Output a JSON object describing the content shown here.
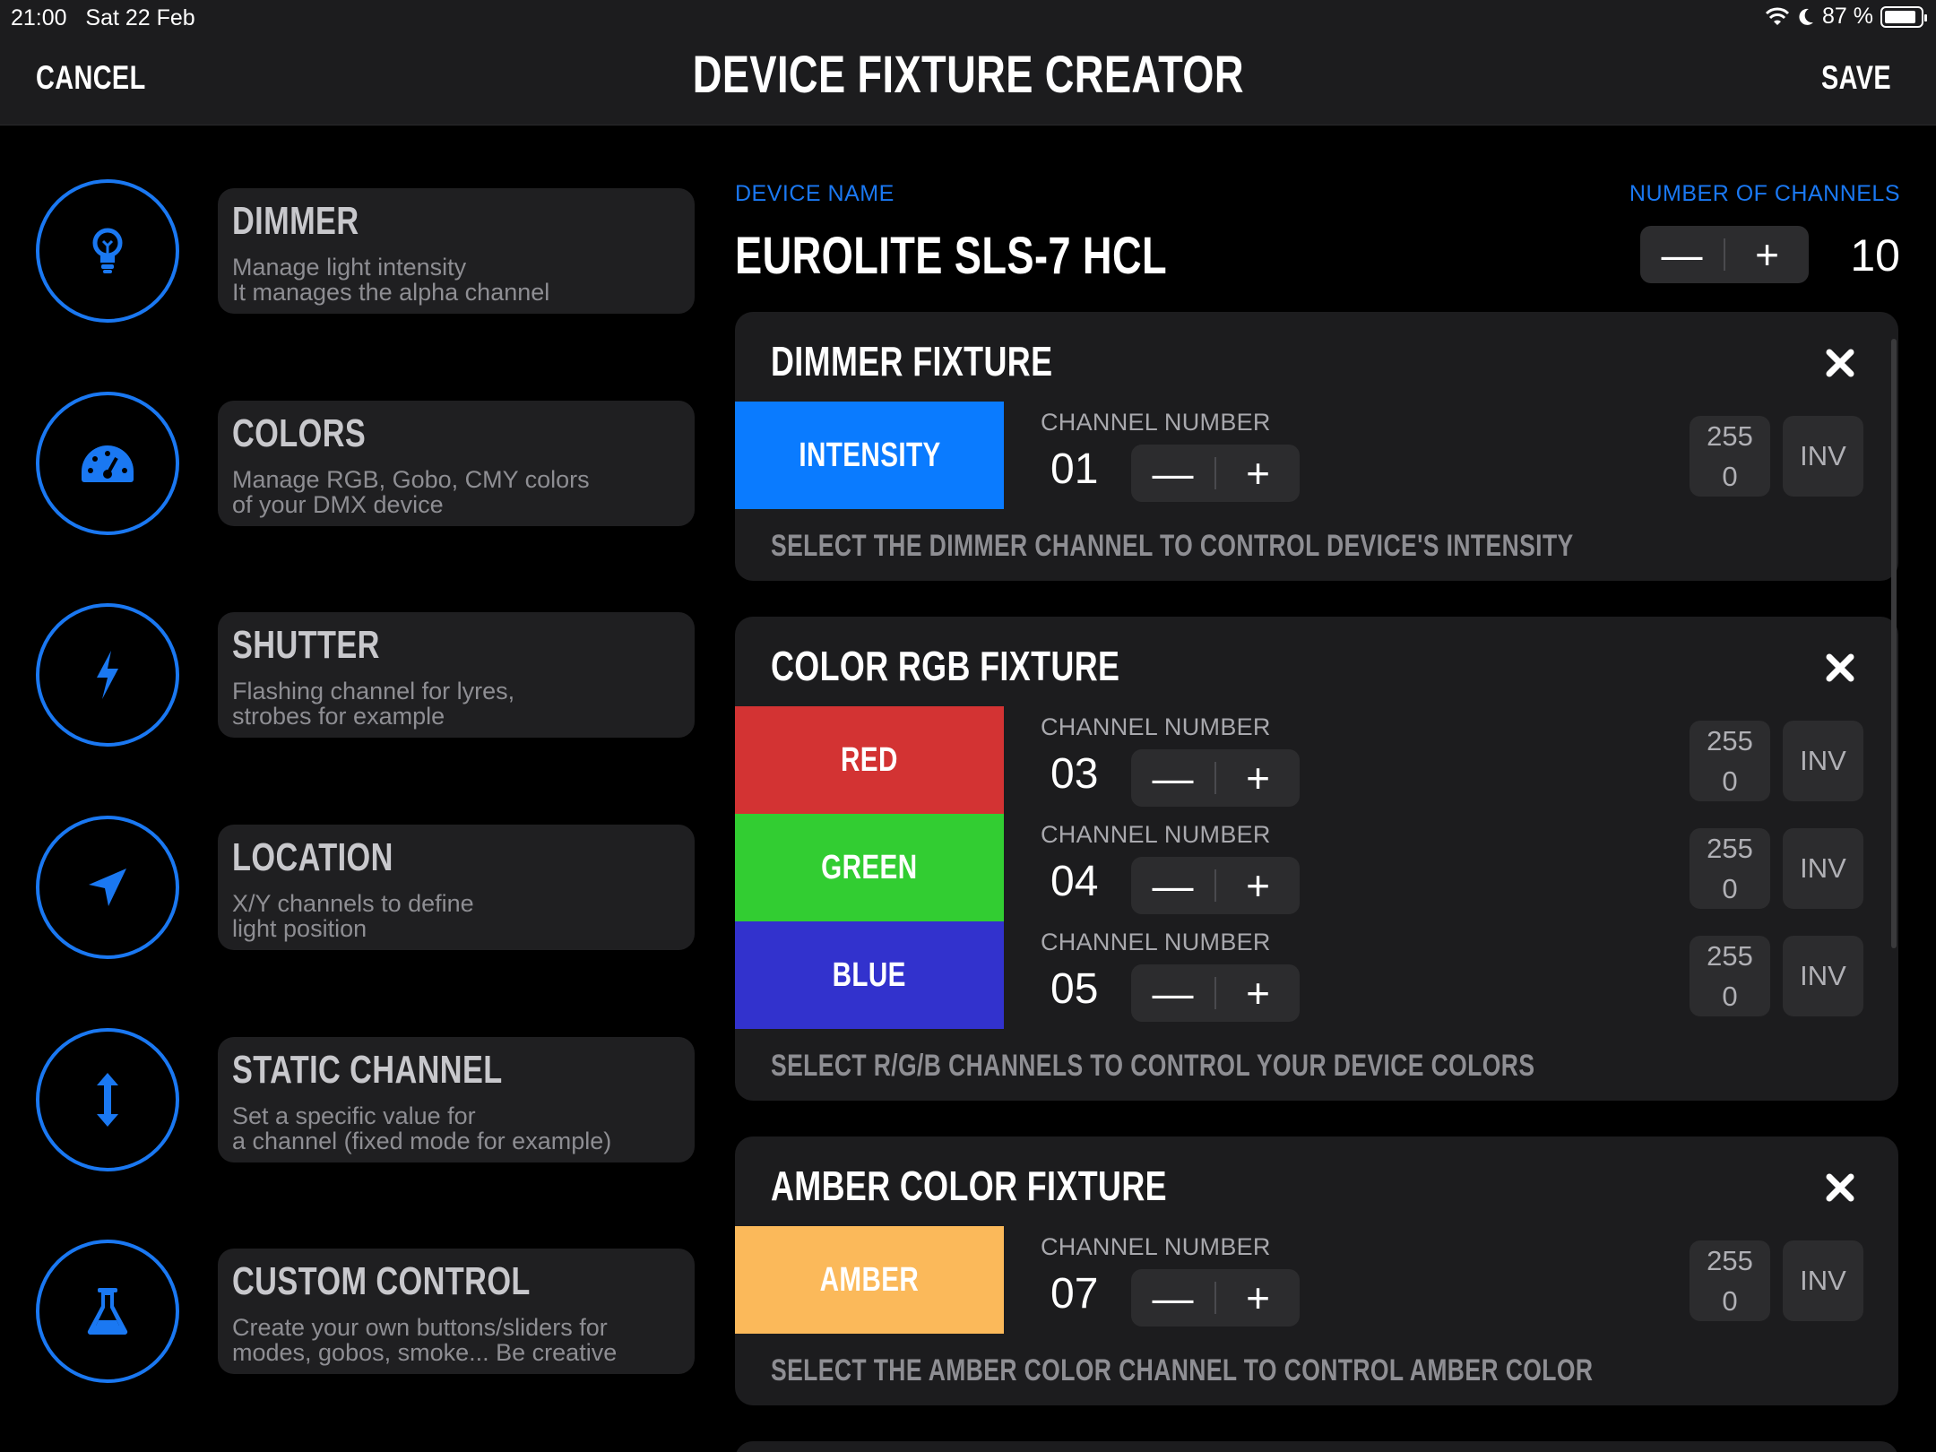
{
  "status_bar": {
    "time": "21:00",
    "date": "Sat 22 Feb",
    "battery": "87 %"
  },
  "nav": {
    "cancel": "CANCEL",
    "title": "DEVICE FIXTURE CREATOR",
    "save": "SAVE"
  },
  "sidebar": {
    "items": [
      {
        "title": "DIMMER",
        "desc": "Manage light intensity\nIt manages the alpha channel",
        "icon": "lightbulb-icon"
      },
      {
        "title": "COLORS",
        "desc": "Manage RGB, Gobo, CMY colors\nof your DMX device",
        "icon": "gauge-icon"
      },
      {
        "title": "SHUTTER",
        "desc": "Flashing channel for lyres,\nstrobes for example",
        "icon": "lightning-icon"
      },
      {
        "title": "LOCATION",
        "desc": "X/Y channels to define\nlight position",
        "icon": "location-arrow-icon"
      },
      {
        "title": "STATIC CHANNEL",
        "desc": "Set a specific value for\na channel (fixed mode for example)",
        "icon": "vertical-arrows-icon"
      },
      {
        "title": "CUSTOM CONTROL",
        "desc": "Create your own buttons/sliders for\nmodes, gobos, smoke... Be creative",
        "icon": "flask-icon"
      }
    ]
  },
  "device": {
    "name_label": "DEVICE NAME",
    "name": "EUROLITE SLS-7 HCL",
    "channels_label": "NUMBER OF CHANNELS",
    "channels": "10",
    "minus": "—",
    "plus": "+"
  },
  "fixtures": [
    {
      "title": "DIMMER FIXTURE",
      "hint": "SELECT THE DIMMER CHANNEL TO CONTROL DEVICE'S INTENSITY",
      "channels": [
        {
          "name": "INTENSITY",
          "color": "#0a7bff",
          "label": "CHANNEL NUMBER",
          "number": "01",
          "max": "255",
          "min": "0",
          "inv": "INV"
        }
      ]
    },
    {
      "title": "COLOR RGB FIXTURE",
      "hint": "SELECT R/G/B CHANNELS TO CONTROL YOUR DEVICE COLORS",
      "channels": [
        {
          "name": "RED",
          "color": "#d33333",
          "label": "CHANNEL NUMBER",
          "number": "03",
          "max": "255",
          "min": "0",
          "inv": "INV"
        },
        {
          "name": "GREEN",
          "color": "#32cd32",
          "label": "CHANNEL NUMBER",
          "number": "04",
          "max": "255",
          "min": "0",
          "inv": "INV"
        },
        {
          "name": "BLUE",
          "color": "#3232cd",
          "label": "CHANNEL NUMBER",
          "number": "05",
          "max": "255",
          "min": "0",
          "inv": "INV"
        }
      ]
    },
    {
      "title": "AMBER COLOR FIXTURE",
      "hint": "SELECT THE AMBER COLOR CHANNEL TO CONTROL AMBER COLOR",
      "channels": [
        {
          "name": "AMBER",
          "color": "#fbb95a",
          "label": "CHANNEL NUMBER",
          "number": "07",
          "max": "255",
          "min": "0",
          "inv": "INV"
        }
      ]
    }
  ]
}
